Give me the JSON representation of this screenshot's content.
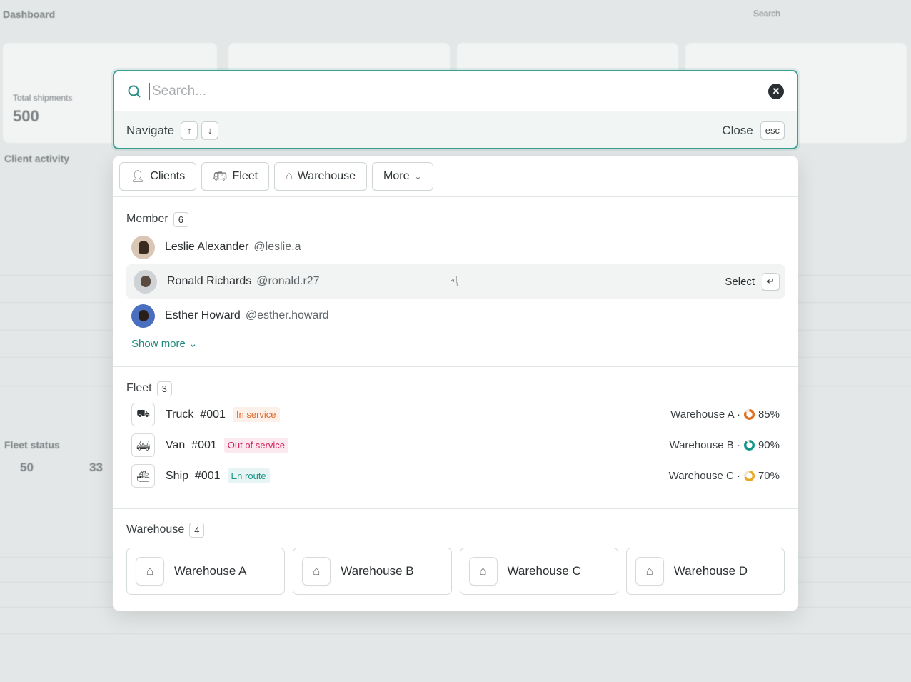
{
  "background": {
    "title": "Dashboard",
    "search": "Search",
    "total_shipments_label": "Total shipments",
    "total_shipments": "500",
    "client_activity": "Client activity",
    "fleet_status": "Fleet status",
    "fleet_total": "50",
    "fleet_active": "33"
  },
  "search": {
    "placeholder": "Search...",
    "navigate_label": "Navigate",
    "up_key": "↑",
    "down_key": "↓",
    "close_label": "Close",
    "esc_key": "esc"
  },
  "filters": [
    {
      "label": "Clients",
      "icon": "user-icon"
    },
    {
      "label": "Fleet",
      "icon": "bus-icon"
    },
    {
      "label": "Warehouse",
      "icon": "warehouse-icon"
    },
    {
      "label": "More",
      "icon": "chevron-down-icon"
    }
  ],
  "members": {
    "title": "Member",
    "count": "6",
    "items": [
      {
        "name": "Leslie Alexander",
        "handle": "@leslie.a"
      },
      {
        "name": "Ronald Richards",
        "handle": "@ronald.r27",
        "selected": true,
        "action": "Select"
      },
      {
        "name": "Esther Howard",
        "handle": "@esther.howard"
      }
    ],
    "show_more": "Show more"
  },
  "fleet": {
    "title": "Fleet",
    "count": "3",
    "items": [
      {
        "type": "Truck",
        "id": "#001",
        "status": "In service",
        "status_color": "#e06a2a",
        "status_bg": "#fdf0e8",
        "warehouse": "Warehouse A ·",
        "percent": "85%",
        "percent_value": 85,
        "ring_color": "#e07020"
      },
      {
        "type": "Van",
        "id": "#001",
        "status": "Out of service",
        "status_color": "#d0245a",
        "status_bg": "#fce9ef",
        "warehouse": "Warehouse B ·",
        "percent": "90%",
        "percent_value": 90,
        "ring_color": "#11978a"
      },
      {
        "type": "Ship",
        "id": "#001",
        "status": "En route",
        "status_color": "#1b9484",
        "status_bg": "#e6f5f3",
        "warehouse": "Warehouse C ·",
        "percent": "70%",
        "percent_value": 70,
        "ring_color": "#e8a820"
      }
    ]
  },
  "warehouses": {
    "title": "Warehouse",
    "count": "4",
    "items": [
      "Warehouse A",
      "Warehouse B",
      "Warehouse C",
      "Warehouse D"
    ]
  },
  "colors": {
    "accent": "#3a9e93",
    "link": "#1f8a7d"
  }
}
